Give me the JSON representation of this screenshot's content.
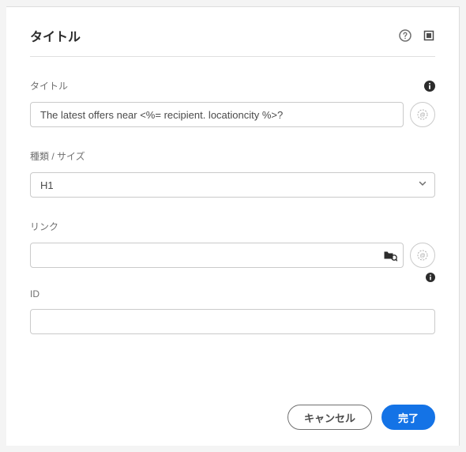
{
  "header": {
    "title": "タイトル"
  },
  "fields": {
    "title": {
      "label": "タイトル",
      "value": "The latest offers near <%= recipient. locationcity %>?"
    },
    "type": {
      "label": "種類 / サイズ",
      "value": "H1"
    },
    "link": {
      "label": "リンク",
      "value": ""
    },
    "id": {
      "label": "ID",
      "value": ""
    }
  },
  "footer": {
    "cancel": "キャンセル",
    "done": "完了"
  }
}
